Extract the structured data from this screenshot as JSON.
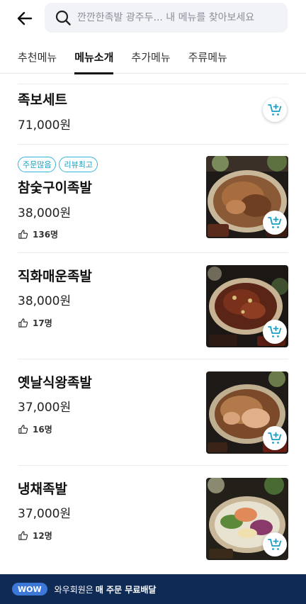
{
  "search": {
    "placeholder": "깐깐한족발 광주두... 내 메뉴를 찾아보세요"
  },
  "tabs": [
    {
      "label": "추천메뉴",
      "active": false
    },
    {
      "label": "메뉴소개",
      "active": true
    },
    {
      "label": "추가메뉴",
      "active": false
    },
    {
      "label": "주류메뉴",
      "active": false
    }
  ],
  "items": [
    {
      "name": "족보세트",
      "price": "71,000원"
    },
    {
      "badges": [
        "주문많음",
        "리뷰최고"
      ],
      "name": "참숯구이족발",
      "price": "38,000원",
      "likes": "136명"
    },
    {
      "name": "직화매운족발",
      "price": "38,000원",
      "likes": "17명"
    },
    {
      "name": "옛날식왕족발",
      "price": "37,000원",
      "likes": "16명"
    },
    {
      "name": "냉채족발",
      "price": "37,000원",
      "likes": "12명"
    }
  ],
  "bottom": {
    "badge": "WOW",
    "text": "와우회원은",
    "strong": "매 주문 무료배달"
  },
  "colors": {
    "accent": "#1a9ec3",
    "bottom_bar": "#0e2a55",
    "wow_badge": "#3b78d8"
  }
}
